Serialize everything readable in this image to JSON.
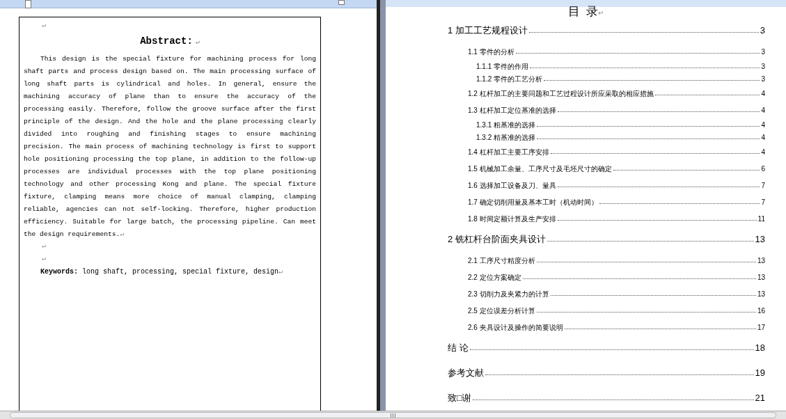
{
  "abstract_page": {
    "blank_before": "↵",
    "title": "Abstract:",
    "title_mark": "↵",
    "body": "This design is the special fixture for machining process for long shaft parts and process design based on. The main processing surface of long shaft parts is cylindrical and holes. In general, ensure the machining accuracy of plane than to ensure the accuracy of the processing easily. Therefore, follow the groove surface after the first principle of the design. And the hole and the plane processing clearly divided into roughing and finishing stages to ensure machining precision. The main process of machining technology is first to support hole positioning processing the top plane, in addition to the follow-up processes are individual processes with the top plane positioning technology and other processing Kong and plane. The special fixture fixture, clamping means more choice of manual clamping, clamping reliable, agencies can not self-locking. Therefore, higher production efficiency. Suitable for large batch, the processing pipeline. Can meet the design requirements.",
    "body_mark": "↵",
    "blank_after": [
      "↵",
      "↵"
    ],
    "keywords_label": "Keywords:",
    "keywords": "long shaft, processing, special fixture, design",
    "keywords_mark": "↵"
  },
  "toc_page": {
    "title": "目  录",
    "title_mark": "↵",
    "entries": [
      {
        "title": "1 加工工艺规程设计",
        "page": "3",
        "children": [
          {
            "title": "1.1 零件的分析",
            "page": "3",
            "children": [
              {
                "title": "1.1.1 零件的作用",
                "page": "3"
              },
              {
                "title": "1.1.2 零件的工艺分析",
                "page": "3"
              }
            ]
          },
          {
            "title": "1.2 杠杆加工的主要问题和工艺过程设计所应采取的相应措施",
            "page": "4"
          },
          {
            "title": "1.3 杠杆加工定位基准的选择",
            "page": "4",
            "children": [
              {
                "title": "1.3.1 粗基准的选择",
                "page": "4"
              },
              {
                "title": "1.3.2 精基准的选择",
                "page": "4"
              }
            ]
          },
          {
            "title": "1.4 杠杆加工主要工序安排",
            "page": "4"
          },
          {
            "title": "1.5 机械加工余量、工序尺寸及毛坯尺寸的确定",
            "page": "6"
          },
          {
            "title": "1.6 选择加工设备及刀、量具",
            "page": "7"
          },
          {
            "title": "1.7 确定切削用量及基本工时（机动时间）",
            "page": "7"
          },
          {
            "title": "1.8 时间定额计算及生产安排",
            "page": "11"
          }
        ]
      },
      {
        "title": "2 铣杠杆台阶面夹具设计",
        "page": "13",
        "children": [
          {
            "title": "2.1 工序尺寸精度分析",
            "page": "13"
          },
          {
            "title": "2.2 定位方案确定",
            "page": "13"
          },
          {
            "title": "2.3 切削力及夹紧力的计算",
            "page": "13"
          },
          {
            "title": "2.5 定位误差分析计算",
            "page": "16"
          },
          {
            "title": "2.6 夹具设计及操作的简要说明",
            "page": "17"
          }
        ]
      },
      {
        "title": "结 论",
        "page": "18"
      },
      {
        "title": "参考文献",
        "page": "19"
      },
      {
        "title": "致□谢",
        "page": "21"
      }
    ]
  }
}
